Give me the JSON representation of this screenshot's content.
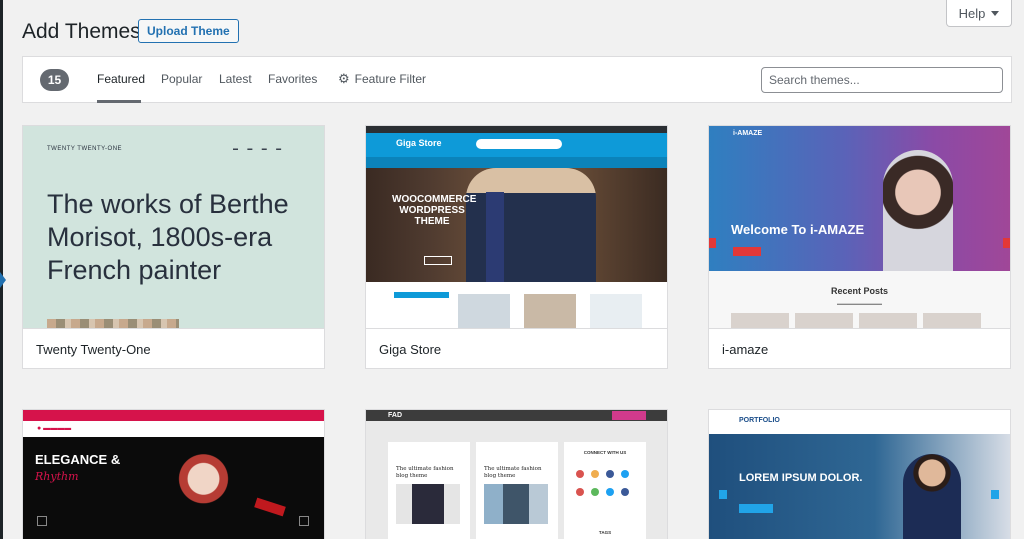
{
  "header": {
    "title": "Add Themes",
    "upload_label": "Upload Theme",
    "help_label": "Help"
  },
  "filter": {
    "count": "15",
    "tabs": [
      "Featured",
      "Popular",
      "Latest",
      "Favorites"
    ],
    "active_tab": "Featured",
    "feature_filter_label": "Feature Filter",
    "search_placeholder": "Search themes..."
  },
  "themes": [
    {
      "name": "Twenty Twenty-One",
      "preview": {
        "site_title": "TWENTY TWENTY-ONE",
        "headline": "The works of Berthe Morisot, 1800s-era French painter"
      }
    },
    {
      "name": "Giga Store",
      "preview": {
        "logo": "Giga Store",
        "hero_text": "WOOCOMMERCE WORDPRESS THEME"
      }
    },
    {
      "name": "i-amaze",
      "preview": {
        "logo": "i-AMAZE",
        "hero_title": "Welcome To i-AMAZE",
        "section_title": "Recent Posts"
      }
    },
    {
      "name": "",
      "preview": {
        "title": "ELEGANCE &",
        "script": "Rhythm"
      }
    },
    {
      "name": "",
      "preview": {
        "logo": "FAD",
        "post_title": "The ultimate fashion blog theme",
        "connect": "CONNECT WITH US",
        "tags": "TAGS"
      }
    },
    {
      "name": "",
      "preview": {
        "logo": "PORTFOLIO",
        "hero_title": "LOREM IPSUM DOLOR."
      }
    }
  ],
  "colors": {
    "accent": "#2271b1",
    "page_bg": "#f1f1f1",
    "count_badge": "#646970"
  },
  "icons": {
    "feature_filter": "gear-icon",
    "help_caret": "caret-down-icon"
  }
}
